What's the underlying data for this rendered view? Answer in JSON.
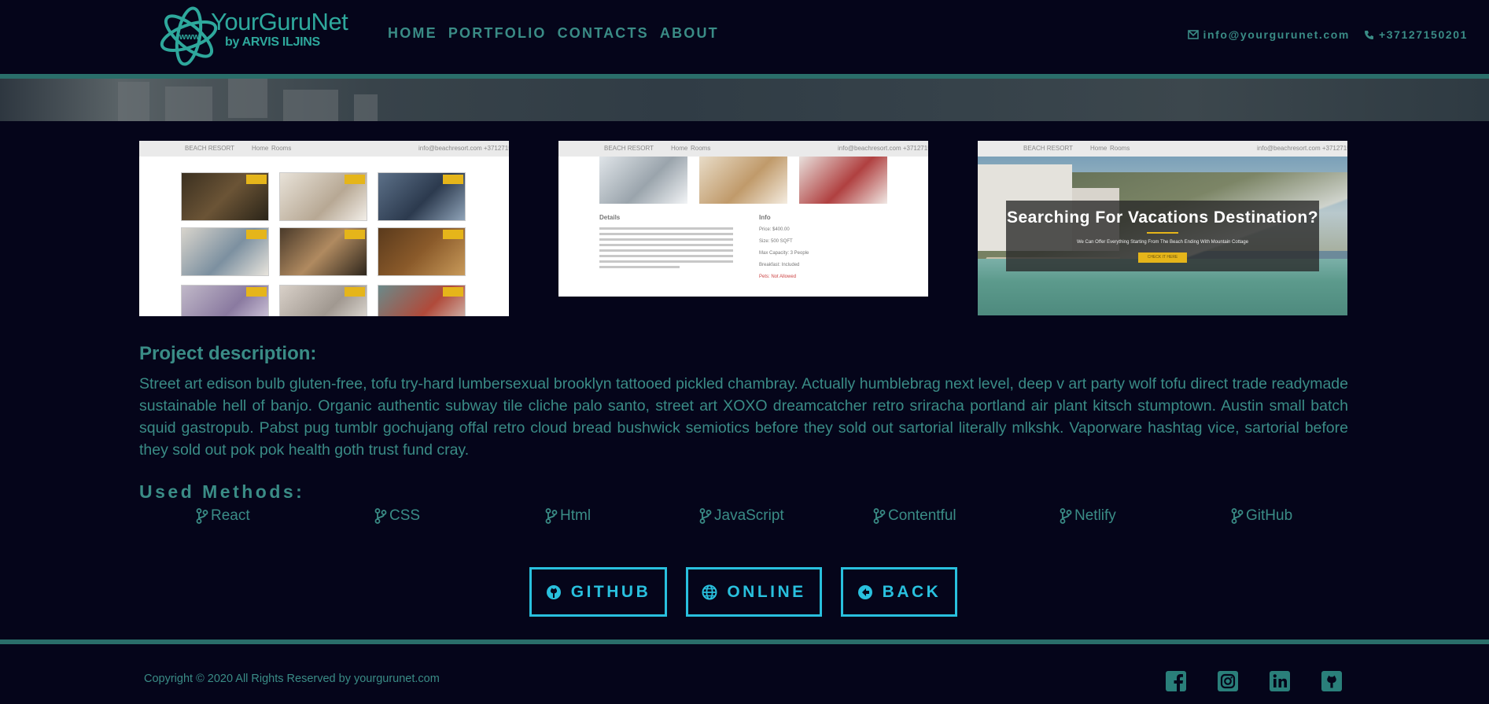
{
  "header": {
    "logo_name": "YourGuruNet",
    "logo_by": "by ARVIS ILJINS",
    "logo_monogram": "www",
    "nav": [
      "HOME",
      "PORTFOLIO",
      "CONTACTS",
      "ABOUT"
    ],
    "email": "info@yourgurunet.com",
    "phone": "+37127150201",
    "email_icon": "envelope-icon",
    "phone_icon": "phone-icon"
  },
  "screenshots": {
    "shot1": {
      "brand": "BEACH RESORT",
      "nav": [
        "Home",
        "Rooms"
      ],
      "contact": "info@beachresort.com  +37127150201",
      "room_prices": [
        "$100.00",
        "$200.00",
        "$400.00",
        "$300.00",
        "$500.00",
        "$400.00",
        "$200.00",
        "$200.00",
        "$100.00"
      ]
    },
    "shot2": {
      "brand": "BEACH RESORT",
      "nav": [
        "Home",
        "Rooms"
      ],
      "contact": "info@beachresort.com  +37127150201",
      "details_heading": "Details",
      "info_heading": "Info",
      "info_lines": [
        "Price: $400.00",
        "Size: 500 SQFT",
        "Max Capacity: 3 People",
        "Breakfast: Included",
        "Pets: Not Allowed"
      ]
    },
    "shot3": {
      "brand": "BEACH RESORT",
      "nav": [
        "Home",
        "Rooms"
      ],
      "contact": "info@beachresort.com  +37127150201",
      "hero_title": "Searching For Vacations Destination?",
      "hero_sub": "We Can Offer Everything Starting From The Beach Ending With Mountain Cottage",
      "hero_button": "CHECK IT HERE"
    }
  },
  "project": {
    "title": "Project description:",
    "text": "Street art edison bulb gluten-free, tofu try-hard lumbersexual brooklyn tattooed pickled chambray. Actually humblebrag next level, deep v art party wolf tofu direct trade readymade sustainable hell of banjo. Organic authentic subway tile cliche palo santo, street art XOXO dreamcatcher retro sriracha portland air plant kitsch stumptown. Austin small batch squid gastropub. Pabst pug tumblr gochujang offal retro cloud bread bushwick semiotics before they sold out sartorial literally mlkshk. Vaporware hashtag vice, sartorial before they sold out pok pok health goth trust fund cray."
  },
  "methods": {
    "title": "Used Methods:",
    "icon": "code-branch-icon",
    "items": [
      "React",
      "CSS",
      "Html",
      "JavaScript",
      "Contentful",
      "Netlify",
      "GitHub"
    ]
  },
  "buttons": {
    "github": "GITHUB",
    "online": "ONLINE",
    "back": "BACK"
  },
  "footer": {
    "copyright": "Copyright © 2020 All Rights Reserved by yourgurunet.com",
    "social": [
      "facebook-icon",
      "instagram-icon",
      "linkedin-icon",
      "github-icon"
    ]
  },
  "colors": {
    "background": "#05051a",
    "text": "#3a8c86",
    "button": "#29c0de",
    "accent_line": "#2a6e6a"
  }
}
